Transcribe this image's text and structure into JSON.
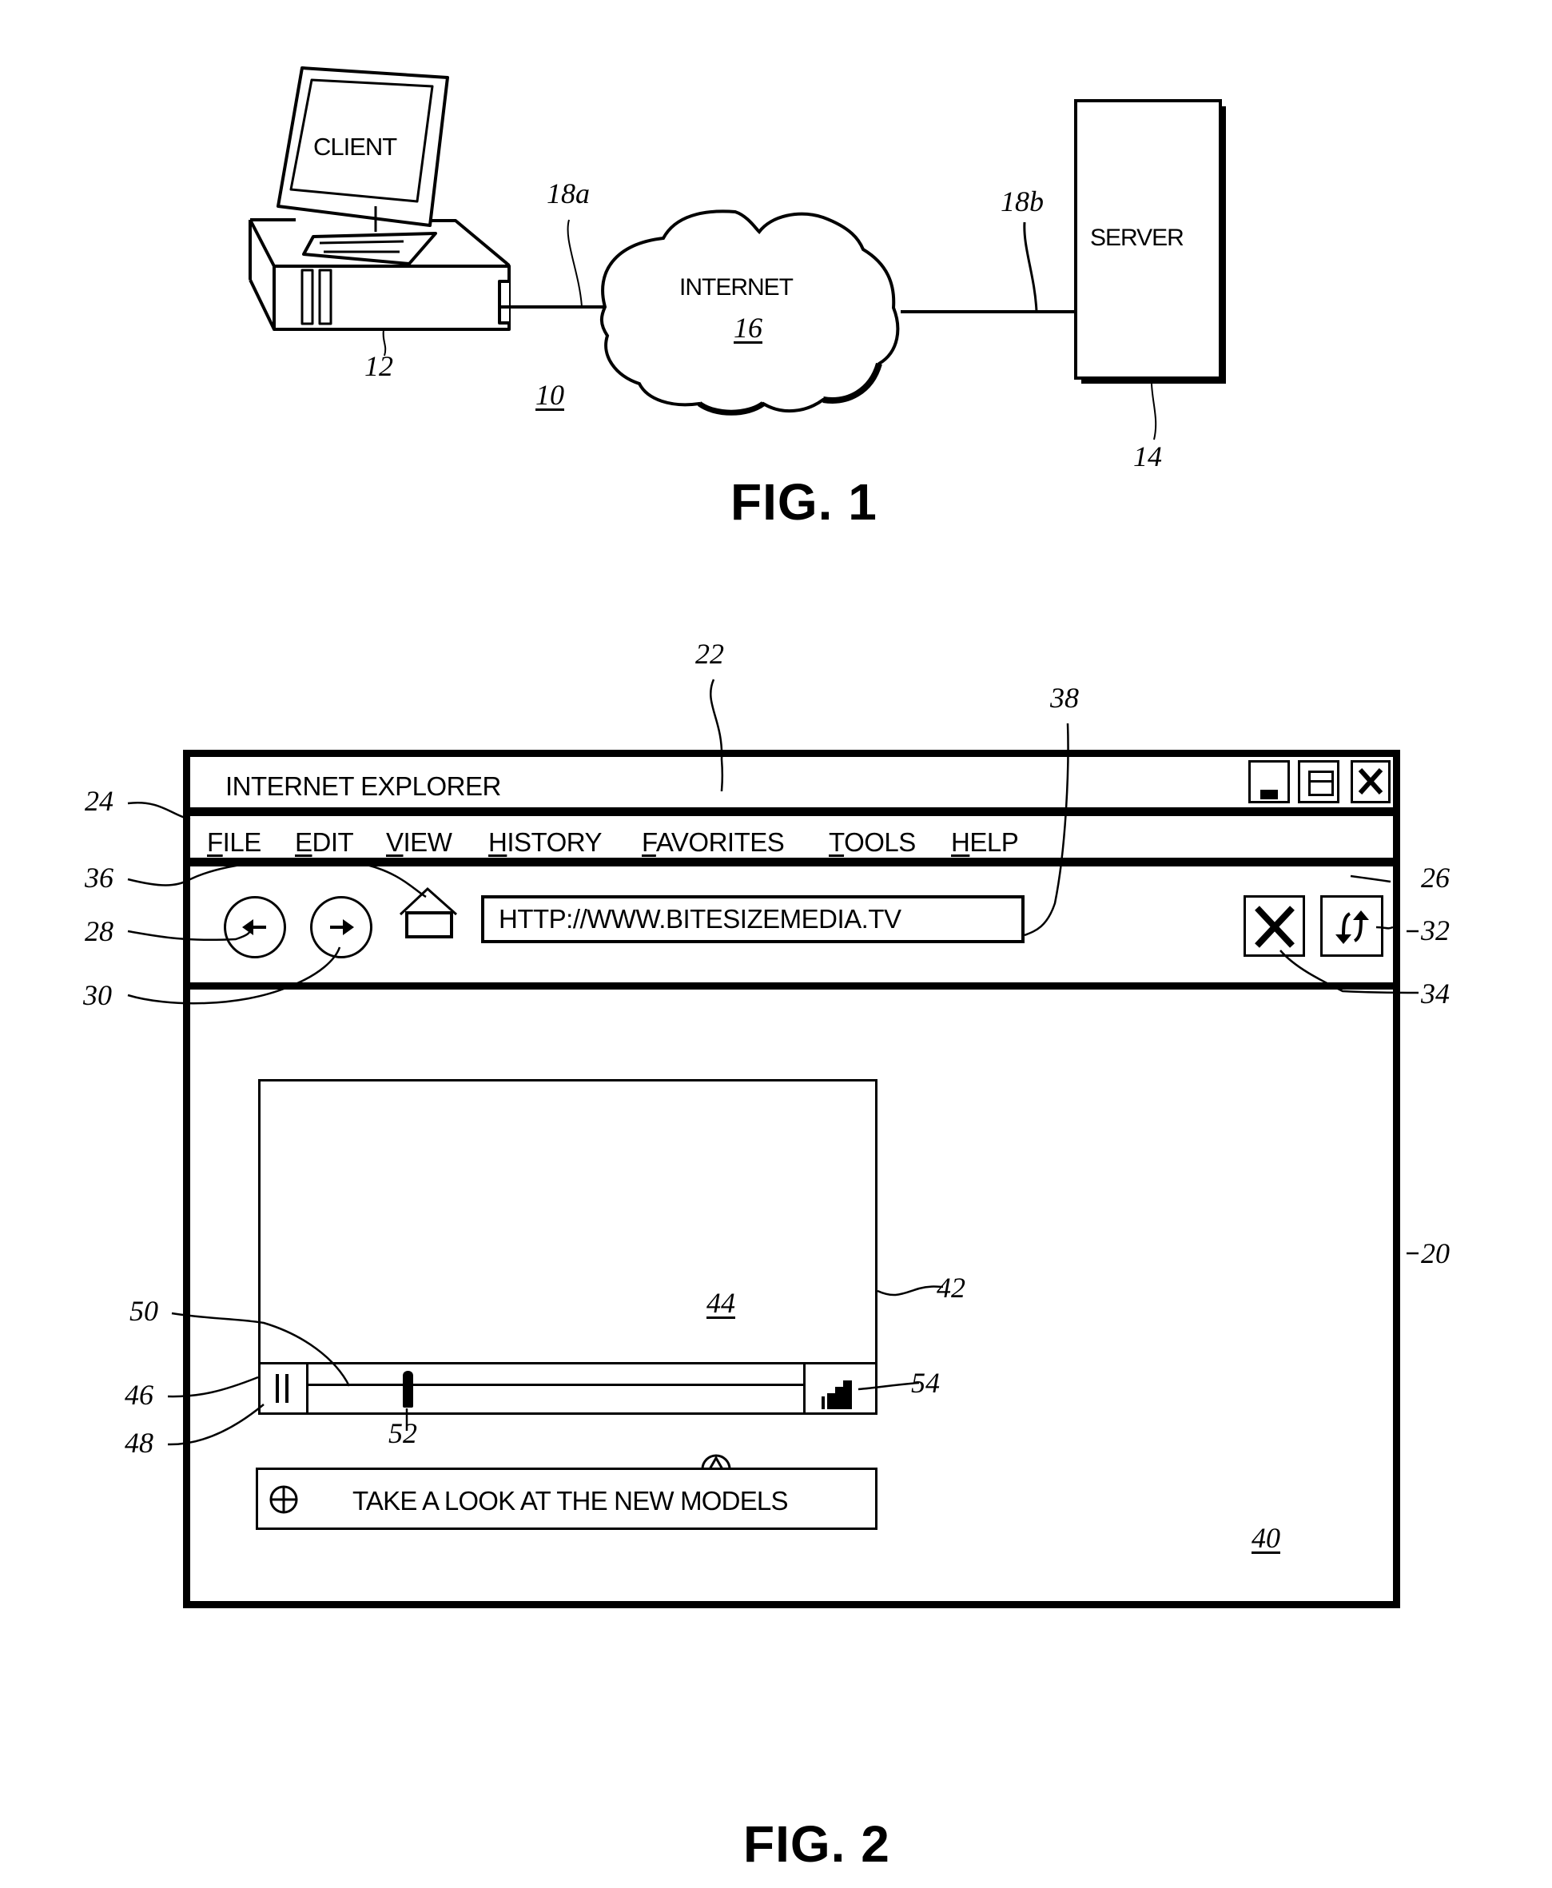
{
  "fig1": {
    "caption": "FIG. 1",
    "client_label": "CLIENT",
    "internet_label": "INTERNET",
    "server_label": "SERVER",
    "refs": {
      "client": "12",
      "server": "14",
      "internet": "16",
      "link_a": "18a",
      "link_b": "18b",
      "system": "10"
    }
  },
  "fig2": {
    "caption": "FIG. 2",
    "window": {
      "title": "INTERNET EXPLORER",
      "controls": [
        {
          "name": "minimize",
          "icon": "minimize-icon"
        },
        {
          "name": "maximize",
          "icon": "maximize-icon"
        },
        {
          "name": "close",
          "icon": "close-icon"
        }
      ]
    },
    "menu": [
      {
        "accel": "F",
        "rest": "ILE"
      },
      {
        "accel": "E",
        "rest": "DIT"
      },
      {
        "accel": "V",
        "rest": "IEW"
      },
      {
        "accel": "H",
        "rest": "ISTORY"
      },
      {
        "accel": "F",
        "rest": "AVORITES"
      },
      {
        "accel": "T",
        "rest": "OOLS"
      },
      {
        "accel": "H",
        "rest": "ELP"
      }
    ],
    "toolbar": {
      "back_icon": "back-arrow-icon",
      "forward_icon": "forward-arrow-icon",
      "home_icon": "home-icon",
      "address_value": "HTTP://WWW.BITESIZEMEDIA.TV",
      "stop_icon": "stop-x-icon",
      "refresh_icon": "refresh-icon"
    },
    "player": {
      "pause_icon": "pause-icon",
      "volume_icon": "volume-icon",
      "seek_position": 0.2,
      "expand_icon": "expand-up-icon"
    },
    "banner": {
      "icon": "plus-circle-icon",
      "text": "TAKE A LOOK AT THE NEW MODELS"
    },
    "refs": {
      "display": "20",
      "browser": "22",
      "menu_bar": "24",
      "toolbar": "26",
      "back": "28",
      "forward": "30",
      "refresh": "32",
      "stop": "34",
      "home": "36",
      "address": "38",
      "page": "40",
      "player": "42",
      "video_area": "44",
      "control_bar": "46",
      "pause": "48",
      "seek_bar": "50",
      "seek_slider": "52",
      "volume": "54"
    }
  }
}
